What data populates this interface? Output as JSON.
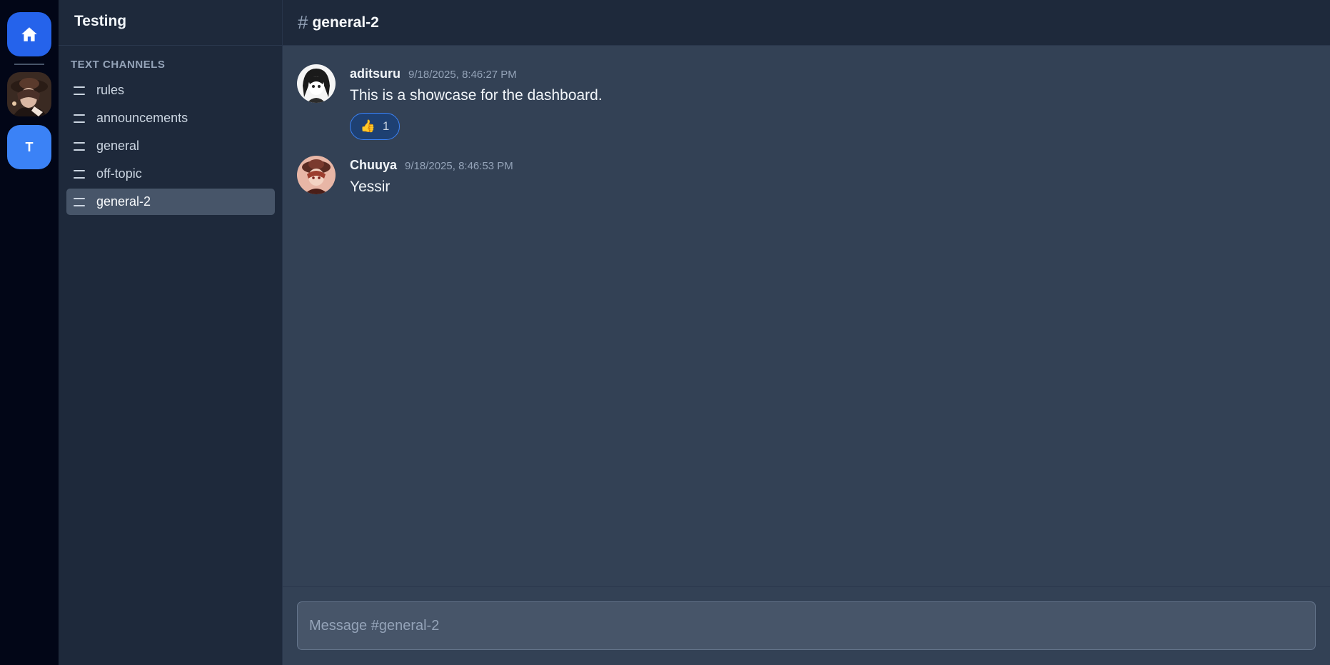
{
  "rail": {
    "home_icon": "home-icon",
    "servers": [
      {
        "type": "image",
        "name": "anime-server"
      },
      {
        "type": "letter",
        "label": "T"
      }
    ]
  },
  "sidebar": {
    "server_name": "Testing",
    "section_title": "TEXT CHANNELS",
    "channels": [
      {
        "label": "rules",
        "active": false
      },
      {
        "label": "announcements",
        "active": false
      },
      {
        "label": "general",
        "active": false
      },
      {
        "label": "off-topic",
        "active": false
      },
      {
        "label": "general-2",
        "active": true
      }
    ]
  },
  "header": {
    "hash": "#",
    "channel": "general-2"
  },
  "messages": [
    {
      "author": "aditsuru",
      "timestamp": "9/18/2025, 8:46:27 PM",
      "text": "This is a showcase for the dashboard.",
      "reaction": {
        "emoji": "👍",
        "count": "1"
      }
    },
    {
      "author": "Chuuya",
      "timestamp": "9/18/2025, 8:46:53 PM",
      "text": "Yessir"
    }
  ],
  "composer": {
    "placeholder": "Message #general-2",
    "value": ""
  },
  "colors": {
    "accent": "#2563eb",
    "rail_bg": "#020617",
    "sidebar_bg": "#1e293b",
    "main_bg": "#334155",
    "active_channel": "#475569"
  }
}
